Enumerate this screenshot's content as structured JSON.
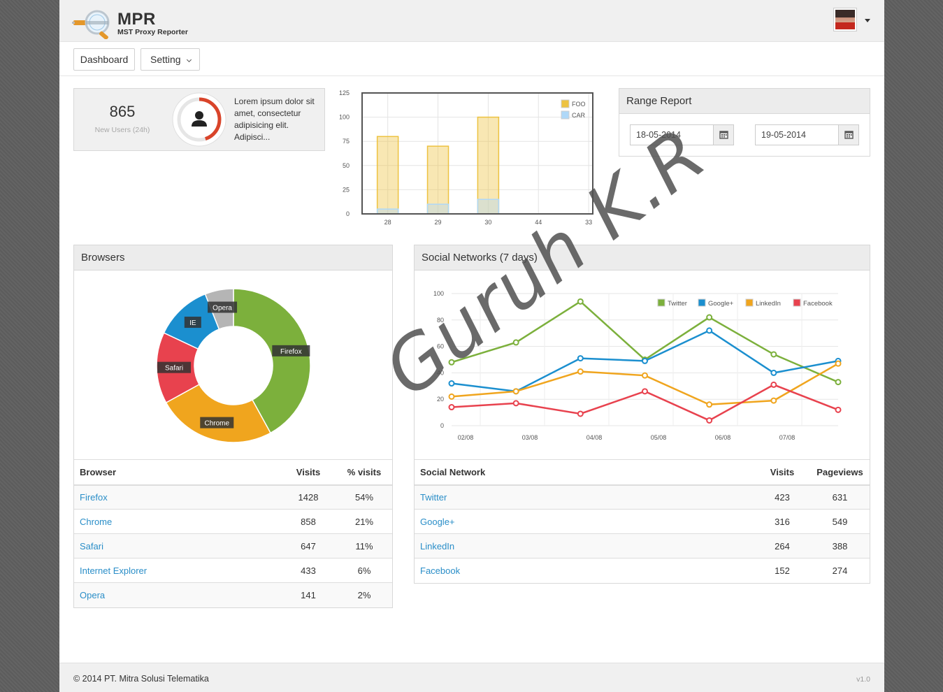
{
  "app": {
    "title": "MPR",
    "subtitle": "MST Proxy Reporter"
  },
  "nav": {
    "dashboard_label": "Dashboard",
    "setting_label": "Setting"
  },
  "stat": {
    "value": "865",
    "label": "New Users (24h)",
    "description": "Lorem ipsum dolor sit amet, consectetur adipisicing elit. Adipisci...",
    "gauge_fraction": 0.45
  },
  "range_report": {
    "title": "Range Report",
    "from": "18-05-2014",
    "to": "19-05-2014"
  },
  "browsers_panel": {
    "title": "Browsers",
    "columns": [
      "Browser",
      "Visits",
      "% visits"
    ],
    "rows": [
      {
        "name": "Firefox",
        "visits": "1428",
        "pct": "54%"
      },
      {
        "name": "Chrome",
        "visits": "858",
        "pct": "21%"
      },
      {
        "name": "Safari",
        "visits": "647",
        "pct": "11%"
      },
      {
        "name": "Internet Explorer",
        "visits": "433",
        "pct": "6%"
      },
      {
        "name": "Opera",
        "visits": "141",
        "pct": "2%"
      }
    ]
  },
  "social_panel": {
    "title": "Social Networks (7 days)",
    "columns": [
      "Social Network",
      "Visits",
      "Pageviews"
    ],
    "rows": [
      {
        "name": "Twitter",
        "visits": "423",
        "views": "631"
      },
      {
        "name": "Google+",
        "visits": "316",
        "views": "549"
      },
      {
        "name": "LinkedIn",
        "visits": "264",
        "views": "388"
      },
      {
        "name": "Facebook",
        "visits": "152",
        "views": "274"
      }
    ]
  },
  "footer": {
    "copyright": "© 2014 PT. Mitra Solusi Telematika",
    "version": "v1.0"
  },
  "watermark": "Guruh K.R",
  "chart_data": [
    {
      "type": "bar",
      "categories": [
        "28",
        "29",
        "30",
        "44",
        "33"
      ],
      "series": [
        {
          "name": "FOO",
          "values": [
            80,
            70,
            100,
            0,
            0
          ],
          "color": "#edc240"
        },
        {
          "name": "CAR",
          "values": [
            5,
            10,
            15,
            0,
            0
          ],
          "color": "#afd8f8"
        }
      ],
      "ylim": [
        0,
        125
      ],
      "yticks": [
        "0",
        "25",
        "50",
        "75",
        "100",
        "125"
      ],
      "legend": "top-right",
      "grid": true
    },
    {
      "type": "pie",
      "donut": true,
      "slices": [
        {
          "label": "Firefox",
          "value": 42,
          "color": "#7cb03c"
        },
        {
          "label": "Chrome",
          "value": 25,
          "color": "#f0a51e"
        },
        {
          "label": "Safari",
          "value": 15,
          "color": "#e8424e"
        },
        {
          "label": "IE",
          "value": 12,
          "color": "#1b8fcf"
        },
        {
          "label": "Opera",
          "value": 6,
          "color": "#b5b5b5"
        }
      ]
    },
    {
      "type": "line",
      "x": [
        0,
        1,
        2,
        3,
        4,
        5,
        6
      ],
      "xticks": [
        "02/08",
        "03/08",
        "04/08",
        "05/08",
        "06/08",
        "07/08"
      ],
      "ylim": [
        0,
        100
      ],
      "yticks": [
        "0",
        "20",
        "40",
        "60",
        "80",
        "100"
      ],
      "legend": "top-right",
      "grid": true,
      "series": [
        {
          "name": "Twitter",
          "color": "#7cb03c",
          "values": [
            48,
            63,
            94,
            50,
            82,
            54,
            33
          ]
        },
        {
          "name": "Google+",
          "color": "#1b8fcf",
          "values": [
            32,
            26,
            51,
            49,
            72,
            40,
            49
          ]
        },
        {
          "name": "LinkedIn",
          "color": "#f0a51e",
          "values": [
            22,
            26,
            41,
            38,
            16,
            19,
            47
          ]
        },
        {
          "name": "Facebook",
          "color": "#e8424e",
          "values": [
            14,
            17,
            9,
            26,
            4,
            31,
            12
          ]
        }
      ]
    }
  ]
}
